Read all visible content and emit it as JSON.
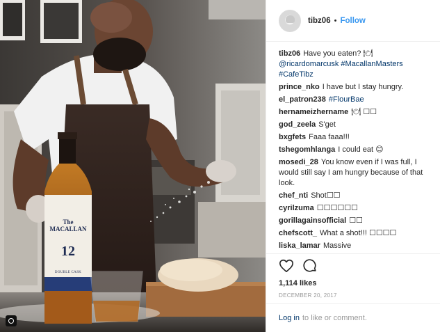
{
  "post": {
    "username": "tibz06",
    "separator": "•",
    "follow_label": "Follow"
  },
  "photo": {
    "bottle_brand": "The MACALLAN",
    "bottle_age": "12",
    "bottle_cask": "DOUBLE CASK"
  },
  "caption": {
    "username": "tibz06",
    "text_plain": "Have you eaten? 🍽",
    "text_tags": "@ricardomarcusk #MacallanMasters #CafeTibz"
  },
  "comments": [
    {
      "username": "prince_nko",
      "text": "I have but I stay hungry."
    },
    {
      "username": "el_patron238",
      "text": "#FlourBae"
    },
    {
      "username": "hernameizhername",
      "text": "🍽 ☐☐"
    },
    {
      "username": "god_zeela",
      "text": "S'get"
    },
    {
      "username": "bxgfets",
      "text": "Faaa faaa!!!"
    },
    {
      "username": "tshegomhlanga",
      "text": "I could eat 😊"
    },
    {
      "username": "mosedi_28",
      "text": "You know even if I was full, I would still say I am hungry because of that look."
    },
    {
      "username": "chef_nti",
      "text": "Shot☐☐"
    },
    {
      "username": "cyrilzuma",
      "text": "☐☐☐☐☐☐"
    },
    {
      "username": "gorillagainsofficial",
      "text": "☐☐"
    },
    {
      "username": "chefscott_",
      "text": "What a shot!!! ☐☐☐☐"
    },
    {
      "username": "liska_lamar",
      "text": "Massive"
    }
  ],
  "actions": {
    "like_icon": "heart-icon",
    "comment_icon": "comment-icon",
    "likes": "1,114 likes",
    "date": "DECEMBER 20, 2017"
  },
  "footer": {
    "login_label": "Log in",
    "rest": "to like or comment."
  }
}
